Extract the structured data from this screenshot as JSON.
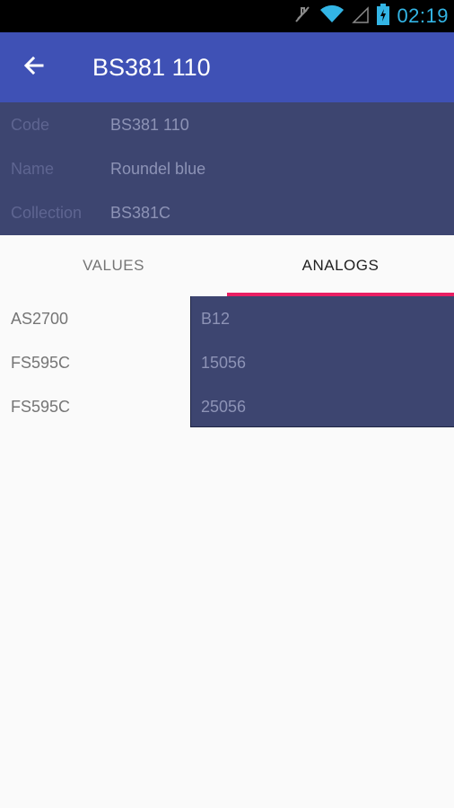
{
  "statusbar": {
    "time": "02:19"
  },
  "appbar": {
    "title": "BS381 110"
  },
  "info": {
    "rows": [
      {
        "label": "Code",
        "value": "BS381 110"
      },
      {
        "label": "Name",
        "value": "Roundel blue"
      },
      {
        "label": "Collection",
        "value": "BS381C"
      }
    ]
  },
  "tabs": [
    {
      "label": "VALUES"
    },
    {
      "label": "ANALOGS"
    }
  ],
  "analogs": [
    {
      "standard": "AS2700",
      "code": "B12"
    },
    {
      "standard": "FS595C",
      "code": "15056"
    },
    {
      "standard": "FS595C",
      "code": "25056"
    }
  ],
  "colors": {
    "primary": "#3f51b5",
    "accent": "#e91e63",
    "swatch": "#3d4570"
  }
}
